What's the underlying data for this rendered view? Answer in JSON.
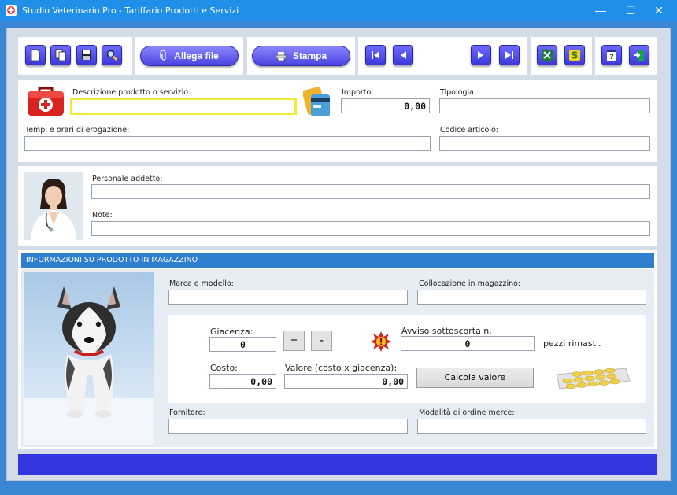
{
  "window": {
    "title": "Studio Veterinario Pro - Tariffario Prodotti e Servizi",
    "minimize": "—",
    "maximize": "☐",
    "close": "✕"
  },
  "toolbar": {
    "attach_label": "Allega file",
    "print_label": "Stampa",
    "buttons": [
      "new-icon",
      "copy-icon",
      "save-icon",
      "search-icon",
      "first-icon",
      "previous-icon",
      "next-icon",
      "last-icon",
      "excel-icon",
      "s-icon",
      "help-icon",
      "exit-icon"
    ],
    "s_label": "S",
    "help_label": "?"
  },
  "product": {
    "description_label": "Descrizione prodotto o servizio:",
    "description_value": "",
    "amount_label": "Importo:",
    "amount_value": "0,00",
    "type_label": "Tipologia:",
    "type_value": "",
    "times_label": "Tempi e orari di erogazione:",
    "times_value": "",
    "code_label": "Codice articolo:",
    "code_value": ""
  },
  "staff": {
    "personnel_label": "Personale addetto:",
    "personnel_value": "",
    "notes_label": "Note:",
    "notes_value": ""
  },
  "warehouse": {
    "section_title": "INFORMAZIONI SU PRODOTTO IN MAGAZZINO",
    "brand_label": "Marca e modello:",
    "brand_value": "",
    "location_label": "Collocazione in magazzino:",
    "location_value": "",
    "stock_label": "Giacenza:",
    "stock_value": "0",
    "plus_label": "+",
    "minus_label": "-",
    "alert_label": "Avviso sottoscorta n.",
    "alert_value": "0",
    "alert_suffix": "pezzi rimasti.",
    "cost_label": "Costo:",
    "cost_value": "0,00",
    "valuation_label": "Valore (costo x giacenza):",
    "valuation_value": "0,00",
    "calc_button": "Calcola valore",
    "supplier_label": "Fornitore:",
    "supplier_value": "",
    "order_label": "Modalità di ordine merce:",
    "order_value": ""
  },
  "colors": {
    "titlebar": "#1f8fe8",
    "toolbar_button": "#4a44e0",
    "section_bar": "#2f7fcf",
    "status_bar": "#3535e0",
    "focus_border": "#f2ea3a"
  }
}
